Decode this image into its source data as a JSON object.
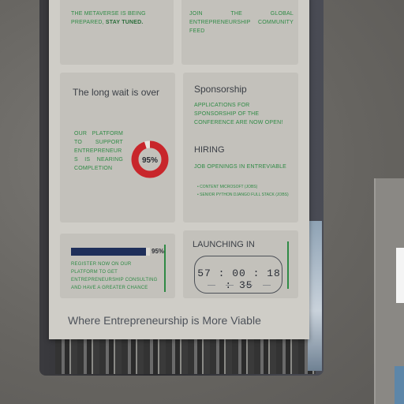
{
  "cards": {
    "metaverse": {
      "text": "THE METAVERSE IS BEING PREPARED,",
      "bold": "STAY TUNED."
    },
    "community": {
      "text": "JOIN THE GLOBAL ENTREPRENEURSHIP COMMUNITY Feed"
    },
    "wait": {
      "title": "The long wait is over",
      "body": "OUR PLATFORM TO SUPPORT ENTREPRENEUR S IS NEARING COMPLETION",
      "percent_label": "95%",
      "percent_value": 95
    },
    "sponsorship": {
      "title": "Sponsorship",
      "body": "APPLICATIONS FOR SPONSORSHIP OF THE CONFERENCE ARE NOW OPEN!",
      "hiring_title": "HIRING",
      "hiring_body": "JOB OPENINGS IN ENTREVIABLE",
      "hiring_items": [
        "• CONTENT MICROSOFT (JOBS)",
        "• SENIOR PYTHON DJANGO FULL STACK (JOBS)"
      ]
    },
    "progress": {
      "percent_label": "95%",
      "percent_value": 95,
      "body": "REGISTER NOW ON OUR PLATFORM TO GET ENTREPRENEURSHIP CONSULTING AND HAVE A GREATER CHANCE"
    },
    "launch": {
      "title": "LAUNCHING IN",
      "countdown": "57 : 00 : 18 : 35"
    }
  },
  "footer": "Where Entrepreneurship is More Viable",
  "colors": {
    "accent_green": "#2f8a45",
    "donut_red": "#c8262b",
    "navy": "#1f2f5a"
  }
}
